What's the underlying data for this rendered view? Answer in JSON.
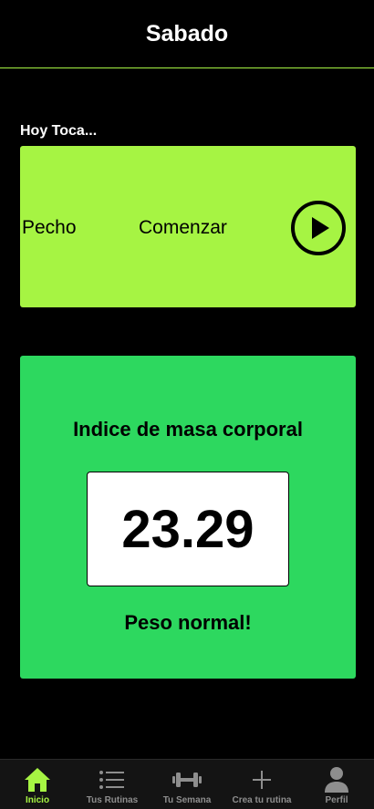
{
  "header": {
    "title": "Sabado"
  },
  "today": {
    "label": "Hoy Toca...",
    "routine_name": "Pecho",
    "start_label": "Comenzar"
  },
  "bmi": {
    "title": "Indice de masa corporal",
    "value": "23.29",
    "status": "Peso normal!"
  },
  "tabbar": {
    "items": [
      {
        "label": "Inicio",
        "icon": "home-icon",
        "active": true
      },
      {
        "label": "Tus Rutinas",
        "icon": "list-icon",
        "active": false
      },
      {
        "label": "Tu Semana",
        "icon": "dumbbell-icon",
        "active": false
      },
      {
        "label": "Crea tu rutina",
        "icon": "plus-icon",
        "active": false
      },
      {
        "label": "Perfil",
        "icon": "person-icon",
        "active": false
      }
    ]
  },
  "colors": {
    "accent": "#a6f443",
    "bmi_card": "#2dd85f",
    "background": "#000000",
    "tab_inactive": "#8e8e8e"
  }
}
